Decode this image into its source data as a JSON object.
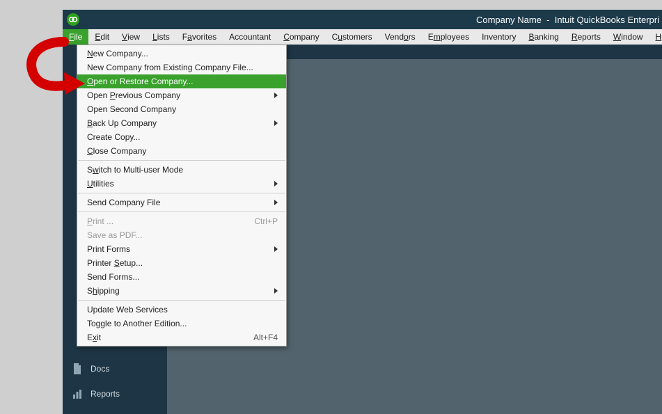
{
  "titlebar": {
    "company": "Company Name",
    "product": "Intuit QuickBooks Enterpri"
  },
  "menubar": {
    "items": [
      {
        "label": "File",
        "mnemonic": 0,
        "active": true
      },
      {
        "label": "Edit",
        "mnemonic": 0
      },
      {
        "label": "View",
        "mnemonic": 0
      },
      {
        "label": "Lists",
        "mnemonic": 0
      },
      {
        "label": "Favorites",
        "mnemonic": 1
      },
      {
        "label": "Accountant",
        "mnemonic": -1
      },
      {
        "label": "Company",
        "mnemonic": 0
      },
      {
        "label": "Customers",
        "mnemonic": 1
      },
      {
        "label": "Vendors",
        "mnemonic": 4
      },
      {
        "label": "Employees",
        "mnemonic": 1
      },
      {
        "label": "Inventory",
        "mnemonic": -1
      },
      {
        "label": "Banking",
        "mnemonic": 0
      },
      {
        "label": "Reports",
        "mnemonic": 0
      },
      {
        "label": "Window",
        "mnemonic": 0
      },
      {
        "label": "Help",
        "mnemonic": 0
      }
    ]
  },
  "dropdown": {
    "groups": [
      [
        {
          "label": "New Company...",
          "mnemonic": 0
        },
        {
          "label": "New Company from Existing Company File..."
        },
        {
          "label": "Open or Restore Company...",
          "mnemonic": 0,
          "highlight": true
        },
        {
          "label": "Open Previous Company",
          "mnemonic": 5,
          "submenu": true
        },
        {
          "label": "Open Second Company"
        },
        {
          "label": "Back Up Company",
          "mnemonic": 0,
          "submenu": true
        },
        {
          "label": "Create Copy..."
        },
        {
          "label": "Close Company",
          "mnemonic": 0
        }
      ],
      [
        {
          "label": "Switch to Multi-user Mode",
          "mnemonic": 1
        },
        {
          "label": "Utilities",
          "mnemonic": 0,
          "submenu": true
        }
      ],
      [
        {
          "label": "Send Company File",
          "mnemonic": 17,
          "submenu": true
        }
      ],
      [
        {
          "label": "Print ...",
          "mnemonic": 0,
          "shortcut": "Ctrl+P",
          "disabled": true
        },
        {
          "label": "Save as PDF...",
          "disabled": true
        },
        {
          "label": "Print Forms",
          "submenu": true
        },
        {
          "label": "Printer Setup...",
          "mnemonic": 8
        },
        {
          "label": "Send Forms..."
        },
        {
          "label": "Shipping",
          "mnemonic": 1,
          "submenu": true
        }
      ],
      [
        {
          "label": "Update Web Services"
        },
        {
          "label": "Toggle to Another Edition..."
        },
        {
          "label": "Exit",
          "mnemonic": 1,
          "shortcut": "Alt+F4"
        }
      ]
    ]
  },
  "sidebar": {
    "docs": "Docs",
    "reports": "Reports"
  }
}
